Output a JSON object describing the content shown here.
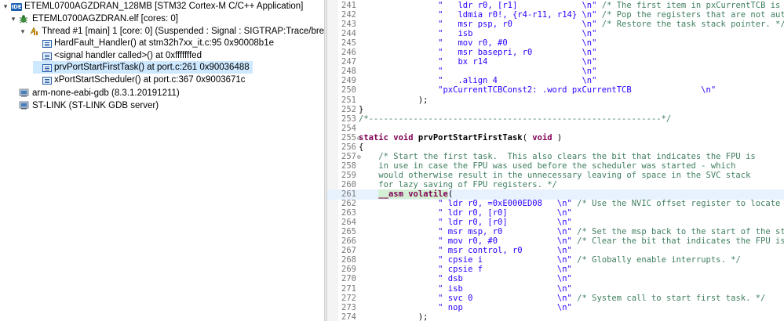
{
  "debug_tree": {
    "rows": [
      {
        "label": "ETEML0700AGZDRAN_128MB [STM32 Cortex-M C/C++ Application]",
        "icon": "ide-icon",
        "twisty": "▾"
      },
      {
        "label": "ETEML0700AGZDRAN.elf [cores: 0]",
        "icon": "debug-bug-icon",
        "twisty": "▾"
      },
      {
        "label": "Thread #1 [main] 1 [core: 0] (Suspended : Signal : SIGTRAP:Trace/breakpoint trap)",
        "icon": "thread-suspended-icon",
        "twisty": "▾"
      },
      {
        "label": "HardFault_Handler() at stm32h7xx_it.c:95 0x90008b1e",
        "icon": "stack-frame-icon",
        "twisty": ""
      },
      {
        "label": "<signal handler called>() at 0xfffffffed",
        "icon": "stack-frame-icon",
        "twisty": ""
      },
      {
        "label": "prvPortStartFirstTask() at port.c:261 0x90036488",
        "icon": "stack-frame-icon",
        "twisty": ""
      },
      {
        "label": "xPortStartScheduler() at port.c:367 0x9003671c",
        "icon": "stack-frame-icon",
        "twisty": ""
      },
      {
        "label": "arm-none-eabi-gdb (8.3.1.20191211)",
        "icon": "gdb-process-icon",
        "twisty": ""
      },
      {
        "label": "ST-LINK (ST-LINK GDB server)",
        "icon": "stlink-process-icon",
        "twisty": ""
      }
    ]
  },
  "editor": {
    "lines": [
      {
        "n": "241",
        "fold": "",
        "segs": [
          {
            "t": "                \"   ",
            "c": "str"
          },
          {
            "t": "ldr r0, [r1]",
            "c": "str"
          },
          {
            "t": "             \\n\"",
            "c": "str"
          },
          {
            "t": " /* The first item in pxCurrentTCB is the task top of stack. */",
            "c": "cmt"
          }
        ]
      },
      {
        "n": "242",
        "fold": "",
        "segs": [
          {
            "t": "                \"   ",
            "c": "str"
          },
          {
            "t": "ldmia r0!, {r4-r11, r14}",
            "c": "str"
          },
          {
            "t": " \\n\"",
            "c": "str"
          },
          {
            "t": " /* Pop the registers that are not automatically saved on exception entry and the critical nesting count. */",
            "c": "cmt"
          }
        ]
      },
      {
        "n": "243",
        "fold": "",
        "segs": [
          {
            "t": "                \"   ",
            "c": "str"
          },
          {
            "t": "msr psp, r0",
            "c": "str"
          },
          {
            "t": "              \\n\"",
            "c": "str"
          },
          {
            "t": " /* Restore the task stack pointer. */",
            "c": "cmt"
          }
        ]
      },
      {
        "n": "244",
        "fold": "",
        "segs": [
          {
            "t": "                \"   ",
            "c": "str"
          },
          {
            "t": "isb",
            "c": "str"
          },
          {
            "t": "                      \\n\"",
            "c": "str"
          }
        ]
      },
      {
        "n": "245",
        "fold": "",
        "segs": [
          {
            "t": "                \"   ",
            "c": "str"
          },
          {
            "t": "mov r0, #0",
            "c": "str"
          },
          {
            "t": "               \\n\"",
            "c": "str"
          }
        ]
      },
      {
        "n": "246",
        "fold": "",
        "segs": [
          {
            "t": "                \"   ",
            "c": "str"
          },
          {
            "t": "msr basepri, r0",
            "c": "str"
          },
          {
            "t": "          \\n\"",
            "c": "str"
          }
        ]
      },
      {
        "n": "247",
        "fold": "",
        "segs": [
          {
            "t": "                \"   ",
            "c": "str"
          },
          {
            "t": "bx r14",
            "c": "str"
          },
          {
            "t": "                   \\n\"",
            "c": "str"
          }
        ]
      },
      {
        "n": "248",
        "fold": "",
        "segs": [
          {
            "t": "                \"                            \\n\"",
            "c": "str"
          }
        ]
      },
      {
        "n": "249",
        "fold": "",
        "segs": [
          {
            "t": "                \"   .align 4                 \\n\"",
            "c": "str"
          }
        ]
      },
      {
        "n": "250",
        "fold": "",
        "segs": [
          {
            "t": "                \"pxCurrentTCBConst2: .word pxCurrentTCB              \\n\"",
            "c": "str"
          }
        ]
      },
      {
        "n": "251",
        "fold": "",
        "segs": [
          {
            "t": "            );",
            "c": ""
          }
        ]
      },
      {
        "n": "252",
        "fold": "",
        "segs": [
          {
            "t": "}",
            "c": ""
          }
        ]
      },
      {
        "n": "253",
        "fold": "",
        "segs": [
          {
            "t": "/*-----------------------------------------------------------*/",
            "c": "cmt"
          }
        ]
      },
      {
        "n": "254",
        "fold": "",
        "segs": [
          {
            "t": "",
            "c": ""
          }
        ]
      },
      {
        "n": "255",
        "fold": "⊖",
        "segs": [
          {
            "t": "static void",
            "c": "kw"
          },
          {
            "t": " ",
            "c": ""
          },
          {
            "t": "prvPortStartFirstTask",
            "c": "bold"
          },
          {
            "t": "( ",
            "c": ""
          },
          {
            "t": "void",
            "c": "kw"
          },
          {
            "t": " )",
            "c": ""
          }
        ]
      },
      {
        "n": "256",
        "fold": "",
        "segs": [
          {
            "t": "{",
            "c": ""
          }
        ]
      },
      {
        "n": "257",
        "fold": "⊖",
        "segs": [
          {
            "t": "    /* Start the first task.  This also clears the bit that indicates the FPU is",
            "c": "cmt"
          }
        ]
      },
      {
        "n": "258",
        "fold": "",
        "segs": [
          {
            "t": "    in use in case the FPU was used before the scheduler was started - which",
            "c": "cmt"
          }
        ]
      },
      {
        "n": "259",
        "fold": "",
        "segs": [
          {
            "t": "    would otherwise result in the unnecessary leaving of space in the SVC stack",
            "c": "cmt"
          }
        ]
      },
      {
        "n": "260",
        "fold": "",
        "segs": [
          {
            "t": "    for lazy saving of FPU registers. */",
            "c": "cmt"
          }
        ]
      },
      {
        "n": "261",
        "fold": "",
        "hl": true,
        "segs": [
          {
            "t": "    ",
            "c": ""
          },
          {
            "t": "__asm volatile",
            "c": "kwasm"
          },
          {
            "t": "(",
            "c": ""
          }
        ]
      },
      {
        "n": "262",
        "fold": "",
        "segs": [
          {
            "t": "                \" ",
            "c": "str"
          },
          {
            "t": "ldr r0, =0xE000ED08",
            "c": "str"
          },
          {
            "t": "   \\n\"",
            "c": "str"
          },
          {
            "t": " /* Use the NVIC offset register to locate the stack. */",
            "c": "cmt"
          }
        ]
      },
      {
        "n": "263",
        "fold": "",
        "segs": [
          {
            "t": "                \" ",
            "c": "str"
          },
          {
            "t": "ldr r0, [r0]",
            "c": "str"
          },
          {
            "t": "          \\n\"",
            "c": "str"
          }
        ]
      },
      {
        "n": "264",
        "fold": "",
        "segs": [
          {
            "t": "                \" ",
            "c": "str"
          },
          {
            "t": "ldr r0, [r0]",
            "c": "str"
          },
          {
            "t": "          \\n\"",
            "c": "str"
          }
        ]
      },
      {
        "n": "265",
        "fold": "",
        "segs": [
          {
            "t": "                \" ",
            "c": "str"
          },
          {
            "t": "msr msp, r0",
            "c": "str"
          },
          {
            "t": "           \\n\"",
            "c": "str"
          },
          {
            "t": " /* Set the msp back to the start of the stack. */",
            "c": "cmt"
          }
        ]
      },
      {
        "n": "266",
        "fold": "",
        "segs": [
          {
            "t": "                \" ",
            "c": "str"
          },
          {
            "t": "mov r0, #0",
            "c": "str"
          },
          {
            "t": "            \\n\"",
            "c": "str"
          },
          {
            "t": " /* Clear the bit that indicates the FPU is in use, see comment above. */",
            "c": "cmt"
          }
        ]
      },
      {
        "n": "267",
        "fold": "",
        "segs": [
          {
            "t": "                \" ",
            "c": "str"
          },
          {
            "t": "msr control, r0",
            "c": "str"
          },
          {
            "t": "       \\n\"",
            "c": "str"
          }
        ]
      },
      {
        "n": "268",
        "fold": "",
        "segs": [
          {
            "t": "                \" ",
            "c": "str"
          },
          {
            "t": "cpsie i",
            "c": "str"
          },
          {
            "t": "               \\n\"",
            "c": "str"
          },
          {
            "t": " /* Globally enable interrupts. */",
            "c": "cmt"
          }
        ]
      },
      {
        "n": "269",
        "fold": "",
        "segs": [
          {
            "t": "                \" ",
            "c": "str"
          },
          {
            "t": "cpsie f",
            "c": "str"
          },
          {
            "t": "               \\n\"",
            "c": "str"
          }
        ]
      },
      {
        "n": "270",
        "fold": "",
        "segs": [
          {
            "t": "                \" ",
            "c": "str"
          },
          {
            "t": "dsb",
            "c": "str"
          },
          {
            "t": "                   \\n\"",
            "c": "str"
          }
        ]
      },
      {
        "n": "271",
        "fold": "",
        "segs": [
          {
            "t": "                \" ",
            "c": "str"
          },
          {
            "t": "isb",
            "c": "str"
          },
          {
            "t": "                   \\n\"",
            "c": "str"
          }
        ]
      },
      {
        "n": "272",
        "fold": "",
        "segs": [
          {
            "t": "                \" ",
            "c": "str"
          },
          {
            "t": "svc 0",
            "c": "str"
          },
          {
            "t": "                 \\n\"",
            "c": "str"
          },
          {
            "t": " /* System call to start first task. */",
            "c": "cmt"
          }
        ]
      },
      {
        "n": "273",
        "fold": "",
        "segs": [
          {
            "t": "                \" ",
            "c": "str"
          },
          {
            "t": "nop",
            "c": "str"
          },
          {
            "t": "                   \\n\"",
            "c": "str"
          }
        ]
      },
      {
        "n": "274",
        "fold": "",
        "segs": [
          {
            "t": "            );",
            "c": ""
          }
        ]
      }
    ]
  },
  "colors": {
    "selection": "#cde8ff",
    "comment": "#3f7f5f",
    "string": "#2a00ff",
    "keyword": "#7f0055",
    "current_line": "#e8f2fe",
    "asm_highlight": "#d4f0d4"
  }
}
